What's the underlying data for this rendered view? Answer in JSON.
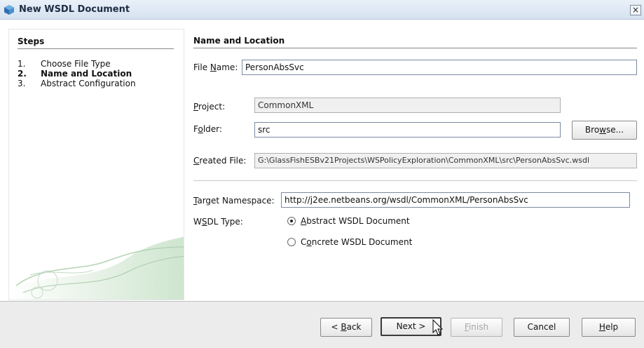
{
  "window": {
    "title": "New WSDL Document",
    "close_glyph": "×"
  },
  "steps": {
    "heading": "Steps",
    "items": [
      {
        "num": "1.",
        "label": "Choose File Type",
        "current": false
      },
      {
        "num": "2.",
        "label": "Name and Location",
        "current": true
      },
      {
        "num": "3.",
        "label": "Abstract Configuration",
        "current": false
      }
    ]
  },
  "section": {
    "heading": "Name and Location"
  },
  "fields": {
    "file_name": {
      "label_pre": "File ",
      "label_u": "N",
      "label_post": "ame:",
      "value": "PersonAbsSvc"
    },
    "project": {
      "label_pre": "",
      "label_u": "P",
      "label_post": "roject:",
      "value": "CommonXML"
    },
    "folder": {
      "label_pre": "F",
      "label_u": "o",
      "label_post": "lder:",
      "value": "src"
    },
    "created_file": {
      "label_pre": "",
      "label_u": "C",
      "label_post": "reated File:",
      "value": "G:\\GlassFishESBv21Projects\\WSPolicyExploration\\CommonXML\\src\\PersonAbsSvc.wsdl"
    },
    "target_namespace": {
      "label_pre": "",
      "label_u": "T",
      "label_post": "arget Namespace:",
      "value": "http://j2ee.netbeans.org/wsdl/CommonXML/PersonAbsSvc"
    },
    "wsdl_type": {
      "label_pre": "W",
      "label_u": "S",
      "label_post": "DL Type:"
    }
  },
  "browse": {
    "label_pre": "Bro",
    "label_u": "w",
    "label_post": "se..."
  },
  "wsdl_options": [
    {
      "label_pre": "",
      "label_u": "A",
      "label_post": "bstract WSDL Document",
      "selected": true
    },
    {
      "label_pre": "C",
      "label_u": "o",
      "label_post": "ncrete WSDL Document",
      "selected": false
    }
  ],
  "buttons": {
    "back": {
      "label_pre": "< ",
      "label_u": "B",
      "label_post": "ack",
      "enabled": true
    },
    "next": {
      "label": "Next >",
      "enabled": true
    },
    "finish": {
      "label_pre": "",
      "label_u": "F",
      "label_post": "inish",
      "enabled": false
    },
    "cancel": {
      "label": "Cancel",
      "enabled": true
    },
    "help": {
      "label_pre": "",
      "label_u": "H",
      "label_post": "elp",
      "enabled": true
    }
  },
  "icons": {
    "title": "wsdl-cube-icon",
    "close": "close-icon",
    "cursor": "mouse-pointer-icon"
  },
  "colors": {
    "titlebar": "#d6e2f0",
    "footer": "#ececec",
    "swirl": "#cfe3cf"
  }
}
